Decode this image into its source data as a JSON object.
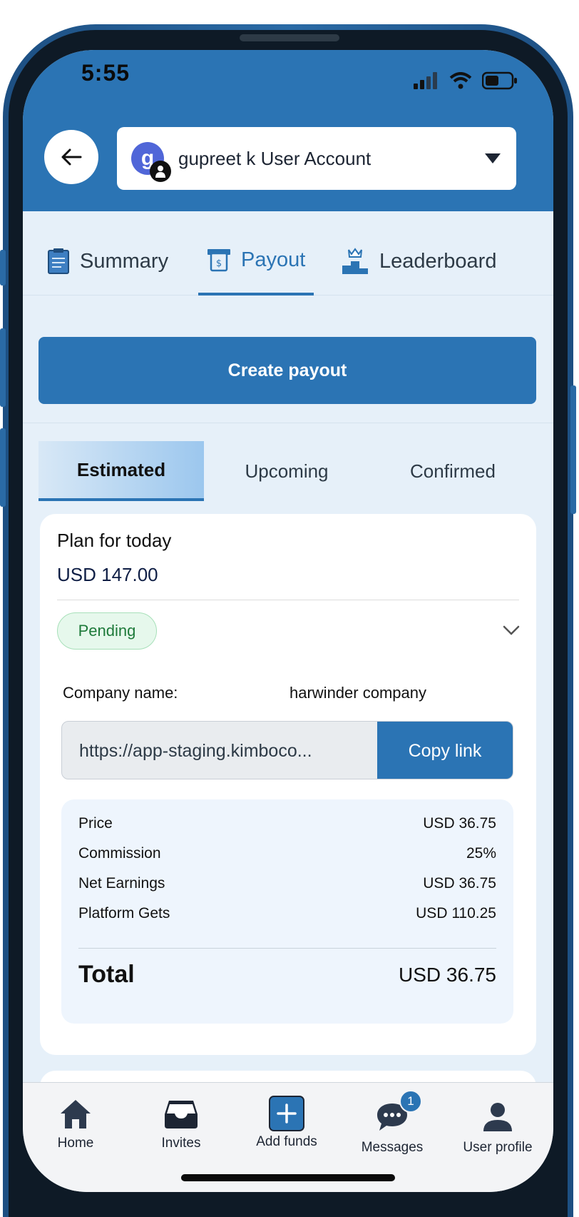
{
  "status_bar": {
    "time": "5:55"
  },
  "header": {
    "account_initial": "g",
    "account_name": "gupreet k User Account"
  },
  "tabs": [
    {
      "label": "Summary",
      "icon": "clipboard-icon",
      "active": false
    },
    {
      "label": "Payout",
      "icon": "atm-icon",
      "active": true
    },
    {
      "label": "Leaderboard",
      "icon": "podium-icon",
      "active": false
    }
  ],
  "create_payout_label": "Create payout",
  "subtabs": [
    {
      "label": "Estimated",
      "active": true
    },
    {
      "label": "Upcoming",
      "active": false
    },
    {
      "label": "Confirmed",
      "active": false
    }
  ],
  "card": {
    "title": "Plan for today",
    "amount": "USD 147.00",
    "status": "Pending",
    "company_label": "Company name:",
    "company_value": "harwinder company",
    "link": "https://app-staging.kimboco...",
    "copy_label": "Copy link",
    "rows": [
      {
        "label": "Price",
        "value": "USD 36.75"
      },
      {
        "label": "Commission",
        "value": "25%"
      },
      {
        "label": "Net Earnings",
        "value": "USD 36.75"
      },
      {
        "label": "Platform Gets",
        "value": "USD 110.25"
      }
    ],
    "total_label": "Total",
    "total_value": "USD 36.75"
  },
  "bottom_nav": [
    {
      "label": "Home",
      "icon": "home-icon"
    },
    {
      "label": "Invites",
      "icon": "inbox-icon"
    },
    {
      "label": "Add funds",
      "icon": "plus-icon"
    },
    {
      "label": "Messages",
      "icon": "chat-icon",
      "badge": "1"
    },
    {
      "label": "User profile",
      "icon": "user-icon"
    }
  ],
  "colors": {
    "primary": "#2b74b4",
    "screen_bg": "#e6f0f9",
    "pending_green": "#1e7a3a"
  }
}
